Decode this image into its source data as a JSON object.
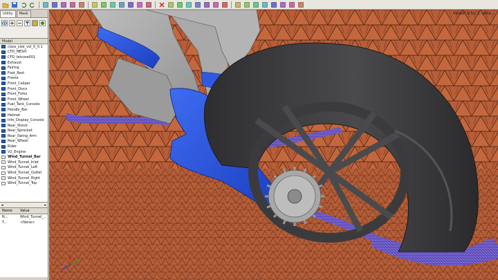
{
  "toolbar": {
    "buttons": [
      "open",
      "save",
      "undo",
      "redo",
      "select",
      "rotate",
      "pan",
      "zoom",
      "fit",
      "front",
      "back",
      "left",
      "right",
      "top",
      "bottom",
      "iso",
      "delete",
      "mask",
      "show",
      "hide",
      "mesh",
      "element",
      "node",
      "find",
      "check",
      "color",
      "style",
      "shade",
      "wire",
      "cut",
      "probe",
      "measure"
    ]
  },
  "tabs": [
    {
      "label": "Utility"
    },
    {
      "label": "Mask"
    }
  ],
  "tree": {
    "header": "Model",
    "items": [
      {
        "label": "class_size_vol_0_0.1",
        "color": "blue",
        "bold": false
      },
      {
        "label": "CFD_MESH",
        "color": "blue",
        "bold": false
      },
      {
        "label": "CFD_tetcore001",
        "color": "blue",
        "bold": false
      },
      {
        "label": "Exhaust",
        "color": "blue",
        "bold": false
      },
      {
        "label": "Fairing",
        "color": "blue",
        "bold": false
      },
      {
        "label": "Foot_Rest",
        "color": "blue",
        "bold": false
      },
      {
        "label": "Frame",
        "color": "blue",
        "bold": false
      },
      {
        "label": "Front_Caliper",
        "color": "blue",
        "bold": false
      },
      {
        "label": "Front_Discs",
        "color": "blue",
        "bold": false
      },
      {
        "label": "Front_Forks",
        "color": "blue",
        "bold": false
      },
      {
        "label": "Front_Wheel",
        "color": "blue",
        "bold": false
      },
      {
        "label": "Fuel_Tank_Console",
        "color": "blue",
        "bold": false
      },
      {
        "label": "Handle_Bar",
        "color": "blue",
        "bold": false
      },
      {
        "label": "Helmet",
        "color": "blue",
        "bold": false
      },
      {
        "label": "Info_Display_Console",
        "color": "blue",
        "bold": false
      },
      {
        "label": "Rear_Shock",
        "color": "blue",
        "bold": false
      },
      {
        "label": "Rear_Sprocket",
        "color": "blue",
        "bold": false
      },
      {
        "label": "Rear_Swing_Arm",
        "color": "blue",
        "bold": false
      },
      {
        "label": "Rear_Wheel",
        "color": "blue",
        "bold": false
      },
      {
        "label": "Rider",
        "color": "blue",
        "bold": false
      },
      {
        "label": "V2_Engine",
        "color": "blue",
        "bold": false
      },
      {
        "label": "Wind_Tunnel_Bar",
        "color": "white",
        "bold": true
      },
      {
        "label": "Wind_Tunnel_Inlet",
        "color": "white",
        "bold": false
      },
      {
        "label": "Wind_Tunnel_Left",
        "color": "white",
        "bold": false
      },
      {
        "label": "Wind_Tunnel_Outlet",
        "color": "white",
        "bold": false
      },
      {
        "label": "Wind_Tunnel_Right",
        "color": "white",
        "bold": false
      },
      {
        "label": "Wind_Tunnel_Top",
        "color": "white",
        "bold": false
      }
    ]
  },
  "properties": {
    "col_name": "Name",
    "col_value": "Value",
    "rows": [
      {
        "name": "N...",
        "value": "Wind_Tunnel_..."
      },
      {
        "name": "T...",
        "value": "<None>"
      }
    ]
  },
  "viewport": {
    "info": "Model Info: C:\\Alte..."
  },
  "colors": {
    "tunnel_mesh": "#c4673d",
    "swing_arm": "#2450d8",
    "tire": "#3a3a3c",
    "boundary_layer": "#6a55c8"
  }
}
